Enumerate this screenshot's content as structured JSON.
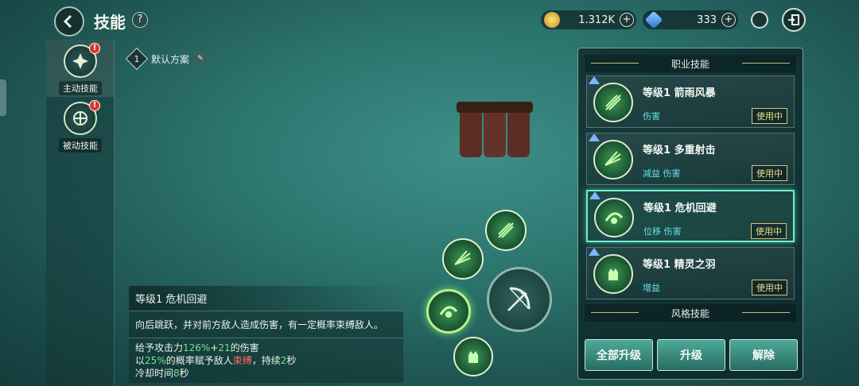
{
  "header": {
    "title": "技能",
    "help_label": "?",
    "gold": "1.312K",
    "diamonds": "333"
  },
  "sidebar": {
    "tabs": [
      {
        "label": "主动技能",
        "badge": "!"
      },
      {
        "label": "被动技能",
        "badge": "!"
      }
    ]
  },
  "preset": {
    "number": "1",
    "name": "默认方案"
  },
  "description": {
    "title": "等级1  危机回避",
    "text": "向后跳跃，并对前方敌人造成伤害，有一定概率束缚敌人。",
    "line1_prefix": "给予攻击力",
    "line1_value1": "126%",
    "line1_mid": "+",
    "line1_value2": "21",
    "line1_suffix": "的伤害",
    "line2_prefix": "以",
    "line2_value": "25%",
    "line2_mid": "的概率赋予敌人",
    "line2_effect": "束缚",
    "line2_mid2": "，持续",
    "line2_duration": "2",
    "line2_suffix": "秒",
    "line3_prefix": "冷却时间",
    "line3_value": "8",
    "line3_suffix": "秒"
  },
  "panel": {
    "section_active": "职业技能",
    "section_style": "风格技能",
    "skills": [
      {
        "name": "等级1  箭雨风暴",
        "tags": "伤害",
        "status": "使用中"
      },
      {
        "name": "等级1  多重射击",
        "tags": "减益  伤害",
        "status": "使用中"
      },
      {
        "name": "等级1  危机回避",
        "tags": "位移  伤害",
        "status": "使用中"
      },
      {
        "name": "等级1  精灵之羽",
        "tags": "增益",
        "status": "使用中"
      }
    ],
    "buttons": {
      "upgrade_all": "全部升级",
      "upgrade": "升级",
      "unequip": "解除"
    }
  },
  "colors": {
    "accent": "#6ff0d0",
    "highlight_green": "#7be08a",
    "highlight_red": "#ff6b5a",
    "tag_cyan": "#64e0e8"
  }
}
